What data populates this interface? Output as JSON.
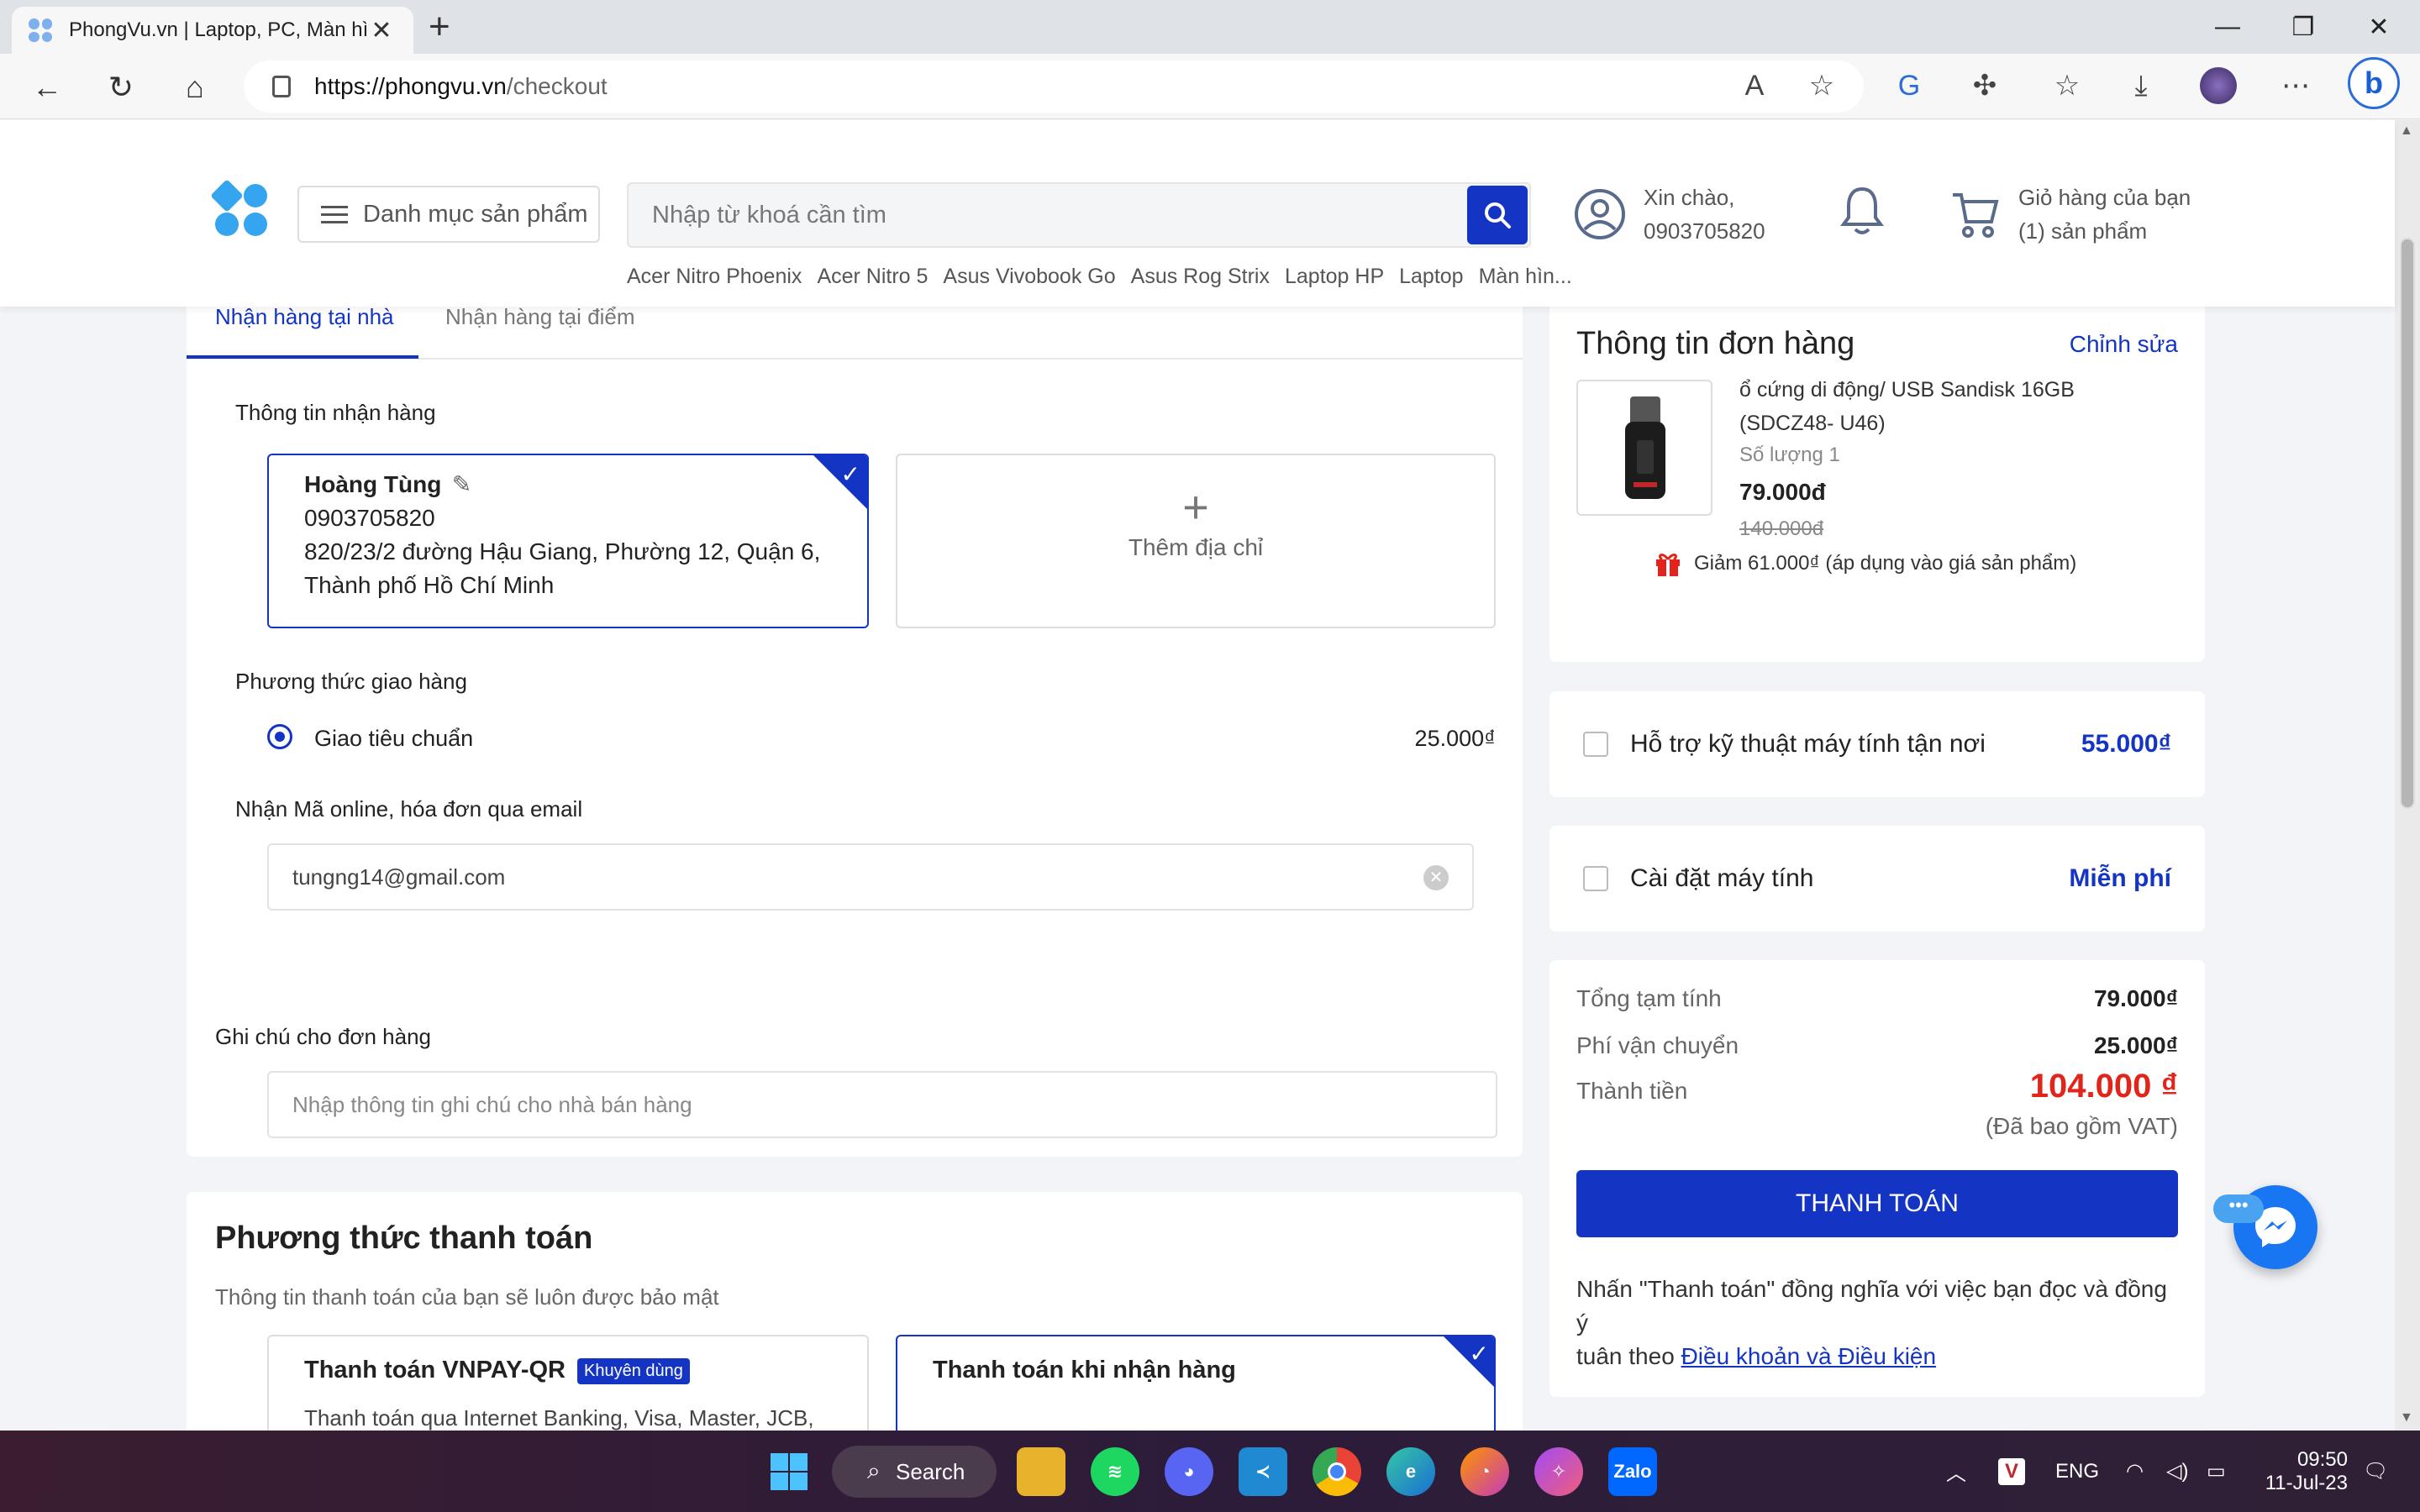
{
  "browser": {
    "tab_title": "PhongVu.vn | Laptop, PC, Màn hình",
    "tab_close": "✕",
    "new_tab": "+",
    "url_host": "https://phongvu.vn",
    "url_path": "/checkout"
  },
  "header": {
    "category_button": "Danh mục sản phẩm",
    "search_placeholder": "Nhập từ khoá cần tìm",
    "suggestions": [
      "Acer Nitro Phoenix",
      "Acer Nitro 5",
      "Asus Vivobook Go",
      "Asus Rog Strix",
      "Laptop HP",
      "Laptop",
      "Màn hìn..."
    ],
    "greeting": "Xin chào,",
    "phone": "0903705820",
    "cart_label": "Giỏ hàng của bạn",
    "cart_count": "(1) sản phẩm"
  },
  "shipping": {
    "tab_home": "Nhận hàng tại nhà",
    "tab_store": "Nhận hàng tại điểm",
    "receive_info_label": "Thông tin nhận hàng",
    "address": {
      "name": "Hoàng Tùng",
      "phone": "0903705820",
      "line1": "820/23/2 đường Hậu Giang, Phường 12, Quận 6,",
      "line2": "Thành phố Hồ Chí Minh"
    },
    "add_address": "Thêm địa chỉ",
    "delivery_method_label": "Phương thức giao hàng",
    "delivery_option": "Giao tiêu chuẩn",
    "delivery_fee": "25.000₫",
    "email_label": "Nhận Mã online, hóa đơn qua email",
    "email_value": "tungng14@gmail.com"
  },
  "note": {
    "label": "Ghi chú cho đơn hàng",
    "placeholder": "Nhập thông tin ghi chú cho nhà bán hàng"
  },
  "payment": {
    "title": "Phương thức thanh toán",
    "subtitle": "Thông tin thanh toán của bạn sẽ luôn được bảo mật",
    "option1_title": "Thanh toán VNPAY-QR",
    "option1_badge": "Khuyên dùng",
    "option1_desc": "Thanh toán qua Internet Banking, Visa, Master, JCB,",
    "option2_title": "Thanh toán khi nhận hàng"
  },
  "order": {
    "title": "Thông tin đơn hàng",
    "edit": "Chỉnh sửa",
    "product_name_1": "ổ cứng di động/ USB Sandisk 16GB",
    "product_name_2": "(SDCZ48- U46)",
    "quantity": "Số lượng 1",
    "price": "79.000đ",
    "old_price": "140.000đ",
    "promo": "Giảm 61.000₫ (áp dụng vào giá sản phẩm)"
  },
  "services": [
    {
      "name": "Hỗ trợ kỹ thuật máy tính tận nơi",
      "price": "55.000₫"
    },
    {
      "name": "Cài đặt máy tính",
      "price": "Miễn phí"
    }
  ],
  "summary": {
    "subtotal_label": "Tổng tạm tính",
    "subtotal": "79.000₫",
    "shipping_label": "Phí vận chuyển",
    "shipping": "25.000₫",
    "total_label": "Thành tiền",
    "total": "104.000 ₫",
    "vat_note": "(Đã bao gồm VAT)",
    "pay_button": "THANH TOÁN",
    "terms_text_1": "Nhấn \"Thanh toán\" đồng nghĩa với việc bạn đọc và đồng ý",
    "terms_text_2": "tuân theo",
    "terms_link": "Điều khoản và Điều kiện"
  },
  "taskbar": {
    "search": "Search",
    "lang": "ENG",
    "time": "09:50",
    "date": "11-Jul-23",
    "zalo": "Zalo"
  },
  "colors": {
    "brand_blue": "#1435c3",
    "price_red": "#e1251b"
  }
}
